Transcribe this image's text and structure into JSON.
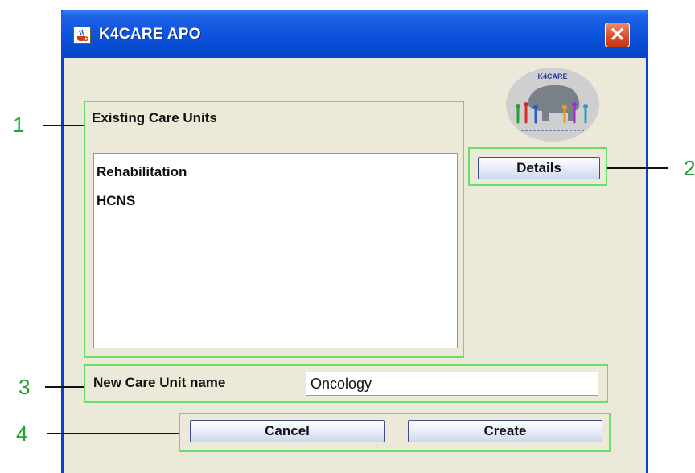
{
  "window": {
    "title": "K4CARE APO",
    "close_glyph": "✕"
  },
  "logo": {
    "text": "K4CARE"
  },
  "existing_units": {
    "label": "Existing Care Units",
    "items": [
      "Rehabilitation",
      "HCNS"
    ]
  },
  "details_button": {
    "label": "Details"
  },
  "new_unit": {
    "label": "New Care Unit name",
    "value": "Oncology"
  },
  "actions": {
    "cancel_label": "Cancel",
    "create_label": "Create"
  },
  "callouts": [
    "1",
    "2",
    "3",
    "4"
  ],
  "colors": {
    "title_bar": "#0a52dd",
    "window_bg": "#ece9d8",
    "highlight_box": "#66e06a",
    "close_button": "#d94a23"
  },
  "icons": [
    "java-cup-icon",
    "close-icon"
  ]
}
